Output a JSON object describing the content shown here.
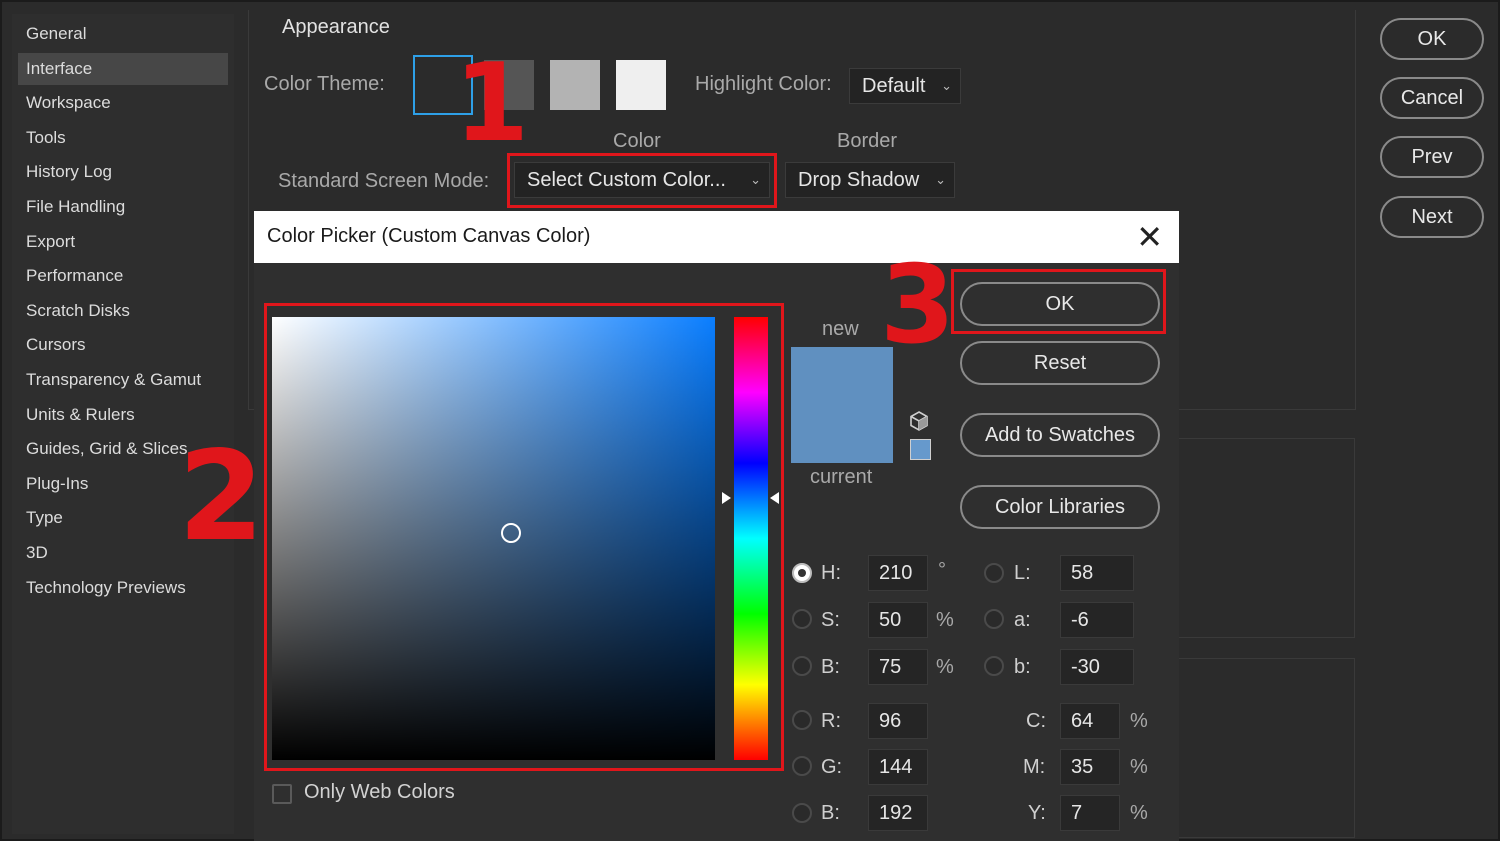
{
  "sidebar": {
    "items": [
      {
        "label": "General"
      },
      {
        "label": "Interface",
        "active": true
      },
      {
        "label": "Workspace"
      },
      {
        "label": "Tools"
      },
      {
        "label": "History Log"
      },
      {
        "label": "File Handling"
      },
      {
        "label": "Export"
      },
      {
        "label": "Performance"
      },
      {
        "label": "Scratch Disks"
      },
      {
        "label": "Cursors"
      },
      {
        "label": "Transparency & Gamut"
      },
      {
        "label": "Units & Rulers"
      },
      {
        "label": "Guides, Grid & Slices"
      },
      {
        "label": "Plug-Ins"
      },
      {
        "label": "Type"
      },
      {
        "label": "3D"
      },
      {
        "label": "Technology Previews"
      }
    ]
  },
  "appearance": {
    "section_title": "Appearance",
    "color_theme_label": "Color Theme:",
    "theme_swatches": [
      "#2b2b2b",
      "#555555",
      "#b3b3b3",
      "#efefef"
    ],
    "highlight_label": "Highlight Color:",
    "highlight_value": "Default",
    "color_col": "Color",
    "border_col": "Border",
    "screen_mode_label": "Standard Screen Mode:",
    "screen_mode_color": "Select Custom Color...",
    "screen_mode_border": "Drop Shadow"
  },
  "right_buttons": {
    "ok": "OK",
    "cancel": "Cancel",
    "prev": "Prev",
    "next": "Next"
  },
  "annotations": {
    "one": "1",
    "two": "2",
    "three": "3",
    "color": "#e0161b"
  },
  "color_picker": {
    "title": "Color Picker (Custom Canvas Color)",
    "new_label": "new",
    "current_label": "current",
    "new_color": "#6090c0",
    "current_color": "#6090c0",
    "buttons": {
      "ok": "OK",
      "reset": "Reset",
      "add_to_swatches": "Add to Swatches",
      "color_libraries": "Color Libraries"
    },
    "only_web_colors": "Only Web Colors",
    "hsb": {
      "h_label": "H:",
      "h_value": "210",
      "h_unit": "°",
      "s_label": "S:",
      "s_value": "50",
      "s_unit": "%",
      "b_label": "B:",
      "b_value": "75",
      "b_unit": "%"
    },
    "lab": {
      "l_label": "L:",
      "l_value": "58",
      "a_label": "a:",
      "a_value": "-6",
      "b_label": "b:",
      "b_value": "-30"
    },
    "rgb": {
      "r_label": "R:",
      "r_value": "96",
      "g_label": "G:",
      "g_value": "144",
      "b_label": "B:",
      "b_value": "192"
    },
    "cmyk": {
      "c_label": "C:",
      "c_value": "64",
      "c_unit": "%",
      "m_label": "M:",
      "m_value": "35",
      "m_unit": "%",
      "y_label": "Y:",
      "y_value": "7",
      "y_unit": "%"
    }
  }
}
